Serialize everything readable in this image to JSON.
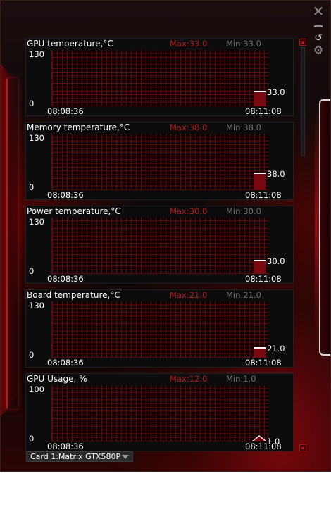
{
  "window": {
    "controls": {
      "close_glyph": "✕",
      "link_glyph": "↺",
      "settings_glyph": "⚙"
    }
  },
  "panels": [
    {
      "title": "GPU temperature,°C",
      "max_label": "Max:33.0",
      "min_label": "Min:33.0",
      "y_max": "130",
      "y_min": "0",
      "time_start": "08:08:36",
      "time_end": "08:11:08",
      "current": "33.0",
      "current_value": 33.0,
      "scale_max": 130,
      "shape": "block"
    },
    {
      "title": "Memory temperature,°C",
      "max_label": "Max:38.0",
      "min_label": "Min:38.0",
      "y_max": "130",
      "y_min": "0",
      "time_start": "08:08:36",
      "time_end": "08:11:08",
      "current": "38.0",
      "current_value": 38.0,
      "scale_max": 130,
      "shape": "block"
    },
    {
      "title": "Power temperature,°C",
      "max_label": "Max:30.0",
      "min_label": "Min:30.0",
      "y_max": "130",
      "y_min": "0",
      "time_start": "08:08:36",
      "time_end": "08:11:08",
      "current": "30.0",
      "current_value": 30.0,
      "scale_max": 130,
      "shape": "block"
    },
    {
      "title": "Board temperature,°C",
      "max_label": "Max:21.0",
      "min_label": "Min:21.0",
      "y_max": "130",
      "y_min": "0",
      "time_start": "08:08:36",
      "time_end": "08:11:08",
      "current": "21.0",
      "current_value": 21.0,
      "scale_max": 130,
      "shape": "block"
    },
    {
      "title": "GPU Usage, %",
      "max_label": "Max:12.0",
      "min_label": "Min:1.0",
      "y_max": "100",
      "y_min": "0",
      "time_start": "08:08:36",
      "time_end": "08:11:08",
      "current": "1.0",
      "current_value": 1.0,
      "peak_value": 12.0,
      "scale_max": 100,
      "shape": "spike"
    }
  ],
  "card_selector": {
    "value": "Card 1:Matrix GTX580P"
  }
}
